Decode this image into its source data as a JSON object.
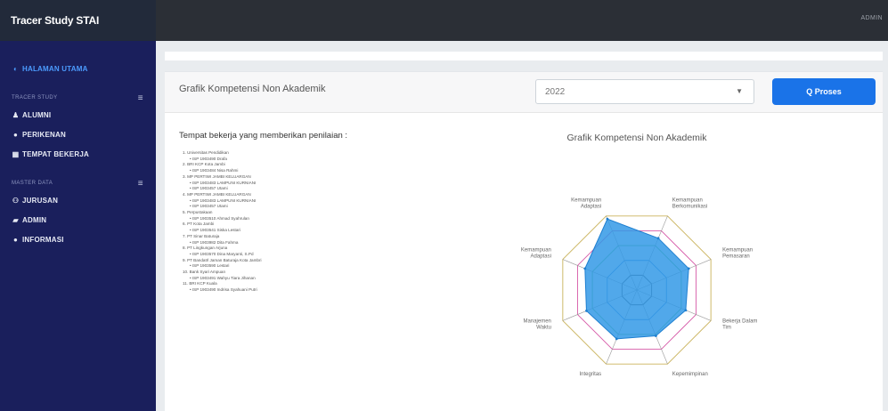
{
  "app": {
    "title": "Tracer Study STAI"
  },
  "topbar": {
    "user": "ADMIN"
  },
  "sidebar": {
    "items": [
      {
        "icon": "tachometer-icon",
        "glyph": "◐",
        "label": "HALAMAN UTAMA",
        "active": true
      }
    ],
    "sections": [
      {
        "heading": "TRACER STUDY",
        "items": [
          {
            "icon": "user-icon",
            "glyph": "♟",
            "label": "ALUMNI"
          },
          {
            "icon": "circle-icon",
            "glyph": "●",
            "label": "PERIKENAN"
          },
          {
            "icon": "building-icon",
            "glyph": "▦",
            "label": "TEMPAT BEKERJA"
          }
        ]
      },
      {
        "heading": "MASTER DATA",
        "items": [
          {
            "icon": "users-icon",
            "glyph": "⚇",
            "label": "JURUSAN"
          },
          {
            "icon": "user-shield-icon",
            "glyph": "▰",
            "label": "ADMIN"
          },
          {
            "icon": "info-icon",
            "glyph": "●",
            "label": "INFORMASI"
          }
        ]
      }
    ]
  },
  "panel": {
    "title": "Grafik Kompetensi Non Akademik",
    "year_selected": "2022",
    "proses_label": "Q Proses"
  },
  "list": {
    "title": "Tempat bekerja yang memberikan penilaian :",
    "entries": [
      {
        "name": "1. Universitas Pendidikan",
        "sub": "ISP 1903490 Drafa"
      },
      {
        "name": "2. BRI KCP Kota Jambi",
        "sub": "ISP 1903484 Nisa Rahmi"
      },
      {
        "name": "3. MP PERTIWI JAMBI KELUARGAN",
        "sub": "ISP 1903483 LAMPUNI KURNIANI"
      },
      {
        "name": "",
        "sub": "ISP 1903457 Utami"
      },
      {
        "name": "4. MP PERTIWI JAMBI KELUARGAN",
        "sub": "ISP 1903483 LAMPUNI KURNIANI"
      },
      {
        "name": "",
        "sub": "ISP 1903457 Utami"
      },
      {
        "name": "5. Perpustakaan",
        "sub": "ISP 1903510 Ahmad Syahrulan"
      },
      {
        "name": "6. PT Kota Jambi",
        "sub": "ISP 1903541 Siska Lestari"
      },
      {
        "name": "7. PT Sinar Baturaja",
        "sub": "ISP 1903982 Dita Fahma"
      },
      {
        "name": "8. PT Lingkungan Arjuna",
        "sub": "ISP 1903570 Dina Maryanti, S.Pd"
      },
      {
        "name": "9. PT Bandatrl Jaman Baturaja Kota Jambri",
        "sub": "ISP 1903590 Lestari"
      },
      {
        "name": "10. Bank Syari Ampuan",
        "sub": "ISP 1903491 Wahyu Tiara Jihanan"
      },
      {
        "name": "11. BRI KCP Kuala",
        "sub": "ISP 1903490 Indrisa Syahuani Putri"
      }
    ]
  },
  "chart_data": {
    "type": "radar",
    "title": "Grafik Kompetensi Non Akademik",
    "categories": [
      "Kemampuan Berkomunikasi",
      "Kemampuan Pemasaran",
      "Bekerja Dalam Tim",
      "Kepemimpinan",
      "Integritas",
      "Manajemen Waktu",
      "Kemampuan Adaptasi",
      "Kemampuan Adaptasi"
    ],
    "series": [
      {
        "values": [
          3.5,
          3.5,
          3.3,
          3.1,
          3.3,
          3.4,
          3.5,
          4.8
        ],
        "color": "#3399e6"
      }
    ],
    "rmax": 5,
    "grid_colors": [
      "#4a4a4a",
      "#3a86d6",
      "#5fbf5f",
      "#d65aa8",
      "#c9b25a"
    ]
  }
}
